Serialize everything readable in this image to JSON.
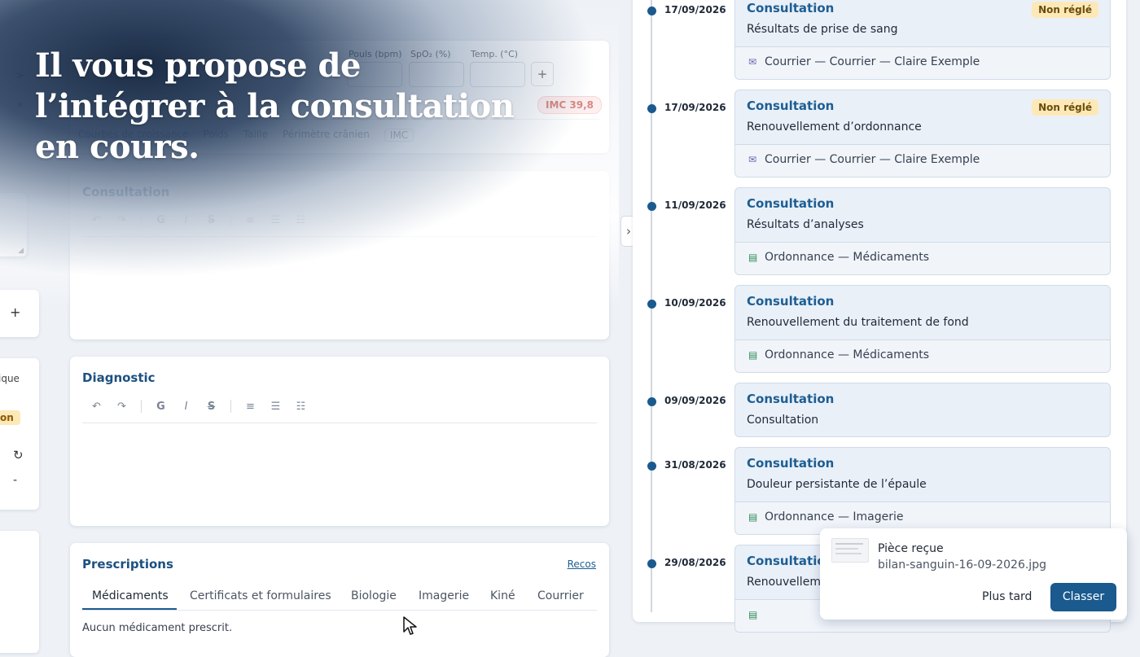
{
  "headline": [
    "Il vous propose de",
    "l’intégrer à la consultation",
    "en cours."
  ],
  "vitals": {
    "labels": [
      "Pouls (bpm)",
      "SpO₂ (%)",
      "Temp. (°C)"
    ],
    "add_label": "+",
    "imc_badge": "IMC 39,8",
    "tabs": [
      "Courbes de croissance",
      "Poids",
      "Taille",
      "Périmètre crânien",
      "IMC"
    ],
    "side_marks": [
      ">",
      "×"
    ]
  },
  "consultation_editor": {
    "title": "Consultation",
    "toolbar": [
      "↶",
      "↷",
      "G",
      "I",
      "S",
      "≡",
      "☰",
      "☷"
    ]
  },
  "diagnostic_editor": {
    "title": "Diagnostic",
    "toolbar": [
      "↶",
      "↷",
      "G",
      "I",
      "S",
      "≡",
      "☰",
      "☷"
    ]
  },
  "left_panel": {
    "plus": "+",
    "partial_text": "ique",
    "partial_badge": "on",
    "refresh": "↻",
    "dash": "-"
  },
  "prescriptions": {
    "title": "Prescriptions",
    "link": "Recos",
    "tabs": [
      "Médicaments",
      "Certificats et formulaires",
      "Biologie",
      "Imagerie",
      "Kiné",
      "Courrier"
    ],
    "active_tab": 0,
    "empty": "Aucun médicament prescrit."
  },
  "collapse_toggle": "›",
  "timeline": [
    {
      "date": "17/09/2026",
      "type": "Consultation",
      "desc": "Résultats de prise de sang",
      "badge": "Non réglé",
      "doc": "Courrier — Courrier — Claire Exemple",
      "doc_icon": "mail-icon"
    },
    {
      "date": "17/09/2026",
      "type": "Consultation",
      "desc": "Renouvellement d’ordonnance",
      "badge": "Non réglé",
      "doc": "Courrier — Courrier — Claire Exemple",
      "doc_icon": "mail-icon"
    },
    {
      "date": "11/09/2026",
      "type": "Consultation",
      "desc": "Résultats d’analyses",
      "badge": "",
      "doc": "Ordonnance — Médicaments",
      "doc_icon": "document-icon"
    },
    {
      "date": "10/09/2026",
      "type": "Consultation",
      "desc": "Renouvellement du traitement de fond",
      "badge": "",
      "doc": "Ordonnance — Médicaments",
      "doc_icon": "document-icon"
    },
    {
      "date": "09/09/2026",
      "type": "Consultation",
      "desc": "Consultation",
      "badge": "",
      "doc": "",
      "doc_icon": ""
    },
    {
      "date": "31/08/2026",
      "type": "Consultation",
      "desc": "Douleur persistante de l’épaule",
      "badge": "",
      "doc": "Ordonnance — Imagerie",
      "doc_icon": "document-icon"
    },
    {
      "date": "29/08/2026",
      "type": "Consultatio",
      "desc": "Renouvellem",
      "badge": "",
      "doc": "",
      "doc_icon": "document-icon"
    }
  ],
  "toast": {
    "title": "Pièce reçue",
    "filename": "bilan-sanguin-16-09-2026.jpg",
    "later": "Plus tard",
    "classify": "Classer"
  },
  "colors": {
    "accent": "#1a5a8e",
    "badge_bg": "#fde9b8",
    "imc_bg": "#fde2e2",
    "imc_text": "#b42318"
  }
}
